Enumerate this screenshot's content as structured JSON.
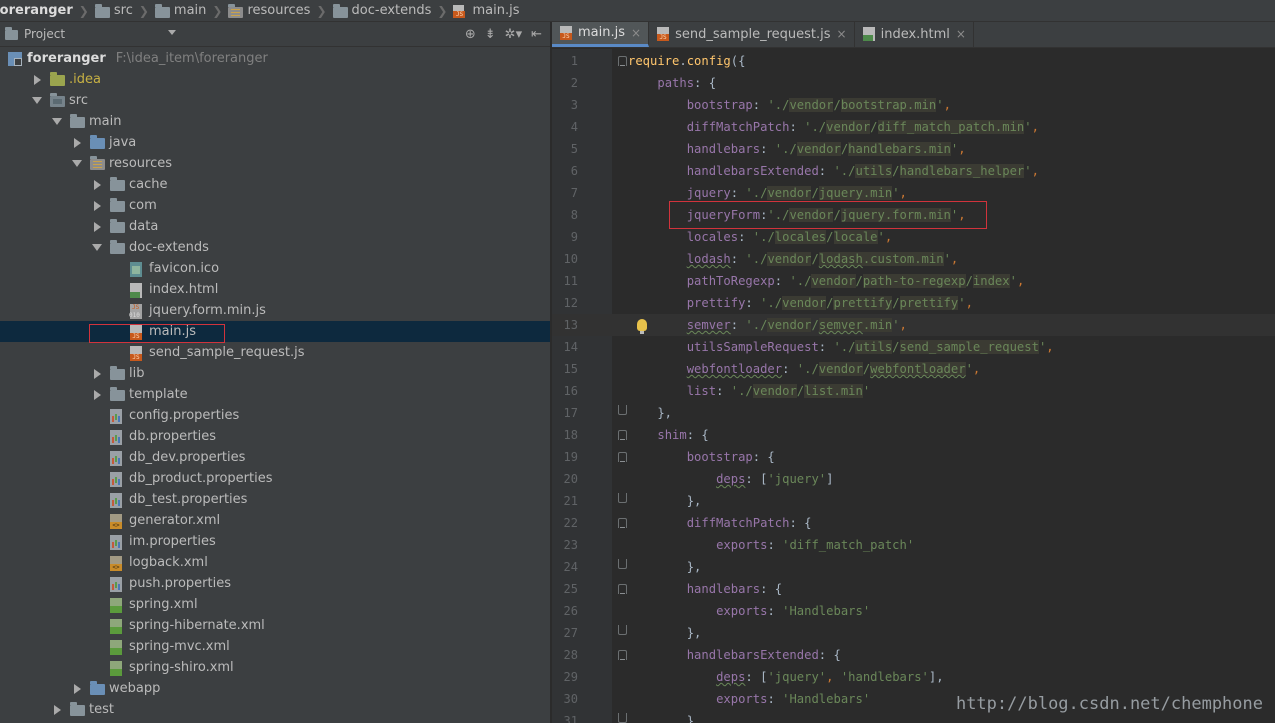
{
  "breadcrumb": [
    "foreranger",
    "src",
    "main",
    "resources",
    "doc-extends",
    "main.js"
  ],
  "project_panel": {
    "title": "Project",
    "root_name": "foreranger",
    "root_path": "F:\\idea_item\\foreranger",
    "tools": [
      "⊕",
      "⇟",
      "✲▾",
      "⇤"
    ]
  },
  "tree": [
    {
      "label": "foreranger",
      "depth": 0,
      "toggle": "none",
      "icon": "module",
      "root": true
    },
    {
      "label": ".idea",
      "depth": 1,
      "toggle": "closed",
      "icon": "folder-idea"
    },
    {
      "label": "src",
      "depth": 1,
      "toggle": "open",
      "icon": "folder-src"
    },
    {
      "label": "main",
      "depth": 2,
      "toggle": "open",
      "icon": "folder"
    },
    {
      "label": "java",
      "depth": 3,
      "toggle": "closed",
      "icon": "folder-blue"
    },
    {
      "label": "resources",
      "depth": 3,
      "toggle": "open",
      "icon": "folder-res"
    },
    {
      "label": "cache",
      "depth": 4,
      "toggle": "closed",
      "icon": "folder"
    },
    {
      "label": "com",
      "depth": 4,
      "toggle": "closed",
      "icon": "folder"
    },
    {
      "label": "data",
      "depth": 4,
      "toggle": "closed",
      "icon": "folder"
    },
    {
      "label": "doc-extends",
      "depth": 4,
      "toggle": "open",
      "icon": "folder"
    },
    {
      "label": "favicon.ico",
      "depth": 5,
      "toggle": "none",
      "icon": "ico"
    },
    {
      "label": "index.html",
      "depth": 5,
      "toggle": "none",
      "icon": "html"
    },
    {
      "label": "jquery.form.min.js",
      "depth": 5,
      "toggle": "none",
      "icon": "minjs"
    },
    {
      "label": "main.js",
      "depth": 5,
      "toggle": "none",
      "icon": "js",
      "selected": true
    },
    {
      "label": "send_sample_request.js",
      "depth": 5,
      "toggle": "none",
      "icon": "js"
    },
    {
      "label": "lib",
      "depth": 4,
      "toggle": "closed",
      "icon": "folder"
    },
    {
      "label": "template",
      "depth": 4,
      "toggle": "closed",
      "icon": "folder"
    },
    {
      "label": "config.properties",
      "depth": 4,
      "toggle": "none",
      "icon": "prop"
    },
    {
      "label": "db.properties",
      "depth": 4,
      "toggle": "none",
      "icon": "prop"
    },
    {
      "label": "db_dev.properties",
      "depth": 4,
      "toggle": "none",
      "icon": "prop"
    },
    {
      "label": "db_product.properties",
      "depth": 4,
      "toggle": "none",
      "icon": "prop"
    },
    {
      "label": "db_test.properties",
      "depth": 4,
      "toggle": "none",
      "icon": "prop"
    },
    {
      "label": "generator.xml",
      "depth": 4,
      "toggle": "none",
      "icon": "xml"
    },
    {
      "label": "im.properties",
      "depth": 4,
      "toggle": "none",
      "icon": "prop"
    },
    {
      "label": "logback.xml",
      "depth": 4,
      "toggle": "none",
      "icon": "xml"
    },
    {
      "label": "push.properties",
      "depth": 4,
      "toggle": "none",
      "icon": "prop"
    },
    {
      "label": "spring.xml",
      "depth": 4,
      "toggle": "none",
      "icon": "spring"
    },
    {
      "label": "spring-hibernate.xml",
      "depth": 4,
      "toggle": "none",
      "icon": "spring"
    },
    {
      "label": "spring-mvc.xml",
      "depth": 4,
      "toggle": "none",
      "icon": "spring"
    },
    {
      "label": "spring-shiro.xml",
      "depth": 4,
      "toggle": "none",
      "icon": "spring"
    },
    {
      "label": "webapp",
      "depth": 3,
      "toggle": "closed",
      "icon": "folder-blue"
    },
    {
      "label": "test",
      "depth": 2,
      "toggle": "closed",
      "icon": "folder"
    }
  ],
  "tabs": [
    {
      "label": "main.js",
      "icon": "js",
      "active": true
    },
    {
      "label": "send_sample_request.js",
      "icon": "js",
      "active": false
    },
    {
      "label": "index.html",
      "icon": "html",
      "active": false
    }
  ],
  "editor": {
    "current_line": 13,
    "bulb_line": 13,
    "lines": [
      {
        "n": 1,
        "fold": "open",
        "tokens": [
          [
            "fn",
            "require"
          ],
          [
            "plain",
            "."
          ],
          [
            "fn",
            "config"
          ],
          [
            "plain",
            "({"
          ]
        ]
      },
      {
        "n": 2,
        "fold": "",
        "tokens": [
          [
            "plain",
            "    "
          ],
          [
            "key",
            "paths"
          ],
          [
            "plain",
            ": {"
          ]
        ]
      },
      {
        "n": 3,
        "fold": "",
        "tokens": [
          [
            "plain",
            "        "
          ],
          [
            "key",
            "bootstrap"
          ],
          [
            "plain",
            ": "
          ],
          [
            "str",
            "'./"
          ],
          [
            "hl",
            "vendor"
          ],
          [
            "str",
            "/"
          ],
          [
            "hl",
            "bootstrap.min"
          ],
          [
            "str",
            "'"
          ],
          [
            "punc",
            ","
          ]
        ]
      },
      {
        "n": 4,
        "fold": "",
        "tokens": [
          [
            "plain",
            "        "
          ],
          [
            "key",
            "diffMatchPatch"
          ],
          [
            "plain",
            ": "
          ],
          [
            "str",
            "'./"
          ],
          [
            "hl",
            "vendor"
          ],
          [
            "str",
            "/"
          ],
          [
            "hl",
            "diff_match_patch.min"
          ],
          [
            "str",
            "'"
          ],
          [
            "punc",
            ","
          ]
        ]
      },
      {
        "n": 5,
        "fold": "",
        "tokens": [
          [
            "plain",
            "        "
          ],
          [
            "key",
            "handlebars"
          ],
          [
            "plain",
            ": "
          ],
          [
            "str",
            "'./"
          ],
          [
            "hl",
            "vendor"
          ],
          [
            "str",
            "/"
          ],
          [
            "hl",
            "handlebars.min"
          ],
          [
            "str",
            "'"
          ],
          [
            "punc",
            ","
          ]
        ]
      },
      {
        "n": 6,
        "fold": "",
        "tokens": [
          [
            "plain",
            "        "
          ],
          [
            "key",
            "handlebarsExtended"
          ],
          [
            "plain",
            ": "
          ],
          [
            "str",
            "'./"
          ],
          [
            "hl",
            "utils"
          ],
          [
            "str",
            "/"
          ],
          [
            "hl",
            "handlebars_helper"
          ],
          [
            "str",
            "'"
          ],
          [
            "punc",
            ","
          ]
        ]
      },
      {
        "n": 7,
        "fold": "",
        "tokens": [
          [
            "plain",
            "        "
          ],
          [
            "key",
            "jquery"
          ],
          [
            "plain",
            ": "
          ],
          [
            "str",
            "'./"
          ],
          [
            "hl",
            "vendor"
          ],
          [
            "str",
            "/"
          ],
          [
            "hl",
            "jquery.min"
          ],
          [
            "str",
            "'"
          ],
          [
            "punc",
            ","
          ]
        ]
      },
      {
        "n": 8,
        "fold": "",
        "tokens": [
          [
            "plain",
            "        "
          ],
          [
            "key",
            "jqueryForm"
          ],
          [
            "plain",
            ":"
          ],
          [
            "str",
            "'./"
          ],
          [
            "hl",
            "vendor"
          ],
          [
            "str",
            "/"
          ],
          [
            "hl",
            "jquery.form.min"
          ],
          [
            "str",
            "'"
          ],
          [
            "punc",
            ","
          ]
        ]
      },
      {
        "n": 9,
        "fold": "",
        "tokens": [
          [
            "plain",
            "        "
          ],
          [
            "key",
            "locales"
          ],
          [
            "plain",
            ": "
          ],
          [
            "str",
            "'./"
          ],
          [
            "hl",
            "locales"
          ],
          [
            "str",
            "/"
          ],
          [
            "hl",
            "locale"
          ],
          [
            "str",
            "'"
          ],
          [
            "punc",
            ","
          ]
        ]
      },
      {
        "n": 10,
        "fold": "",
        "tokens": [
          [
            "plain",
            "        "
          ],
          [
            "keysq",
            "lodash"
          ],
          [
            "plain",
            ": "
          ],
          [
            "str",
            "'./"
          ],
          [
            "hl",
            "vendor"
          ],
          [
            "str",
            "/"
          ],
          [
            "hlsq",
            "lodash"
          ],
          [
            "hl",
            ".custom.min"
          ],
          [
            "str",
            "'"
          ],
          [
            "punc",
            ","
          ]
        ]
      },
      {
        "n": 11,
        "fold": "",
        "tokens": [
          [
            "plain",
            "        "
          ],
          [
            "key",
            "pathToRegexp"
          ],
          [
            "plain",
            ": "
          ],
          [
            "str",
            "'./"
          ],
          [
            "hl",
            "vendor"
          ],
          [
            "str",
            "/"
          ],
          [
            "hl",
            "path-to-regexp"
          ],
          [
            "str",
            "/"
          ],
          [
            "hl",
            "index"
          ],
          [
            "str",
            "'"
          ],
          [
            "punc",
            ","
          ]
        ]
      },
      {
        "n": 12,
        "fold": "",
        "tokens": [
          [
            "plain",
            "        "
          ],
          [
            "key",
            "prettify"
          ],
          [
            "plain",
            ": "
          ],
          [
            "str",
            "'./"
          ],
          [
            "hl",
            "vendor"
          ],
          [
            "str",
            "/"
          ],
          [
            "hl",
            "prettify"
          ],
          [
            "str",
            "/"
          ],
          [
            "hl",
            "prettify"
          ],
          [
            "str",
            "'"
          ],
          [
            "punc",
            ","
          ]
        ]
      },
      {
        "n": 13,
        "fold": "",
        "tokens": [
          [
            "plain",
            "        "
          ],
          [
            "keysq",
            "semver"
          ],
          [
            "plain",
            ": "
          ],
          [
            "str",
            "'./"
          ],
          [
            "hl",
            "vendor"
          ],
          [
            "str",
            "/"
          ],
          [
            "hlsq",
            "semver"
          ],
          [
            "hl",
            ".min"
          ],
          [
            "str",
            "'"
          ],
          [
            "punc",
            ","
          ]
        ]
      },
      {
        "n": 14,
        "fold": "",
        "tokens": [
          [
            "plain",
            "        "
          ],
          [
            "key",
            "utilsSampleRequest"
          ],
          [
            "plain",
            ": "
          ],
          [
            "str",
            "'./"
          ],
          [
            "hl",
            "utils"
          ],
          [
            "str",
            "/"
          ],
          [
            "hl",
            "send_sample_request"
          ],
          [
            "str",
            "'"
          ],
          [
            "punc",
            ","
          ]
        ]
      },
      {
        "n": 15,
        "fold": "",
        "tokens": [
          [
            "plain",
            "        "
          ],
          [
            "keysq",
            "webfontloader"
          ],
          [
            "plain",
            ": "
          ],
          [
            "str",
            "'./"
          ],
          [
            "hl",
            "vendor"
          ],
          [
            "str",
            "/"
          ],
          [
            "hlsq",
            "webfontloader"
          ],
          [
            "str",
            "'"
          ],
          [
            "punc",
            ","
          ]
        ]
      },
      {
        "n": 16,
        "fold": "",
        "tokens": [
          [
            "plain",
            "        "
          ],
          [
            "key",
            "list"
          ],
          [
            "plain",
            ": "
          ],
          [
            "str",
            "'./"
          ],
          [
            "hl",
            "vendor"
          ],
          [
            "str",
            "/"
          ],
          [
            "hl",
            "list.min"
          ],
          [
            "str",
            "'"
          ]
        ]
      },
      {
        "n": 17,
        "fold": "end",
        "tokens": [
          [
            "plain",
            "    },"
          ]
        ]
      },
      {
        "n": 18,
        "fold": "open",
        "tokens": [
          [
            "plain",
            "    "
          ],
          [
            "key",
            "shim"
          ],
          [
            "plain",
            ": {"
          ]
        ]
      },
      {
        "n": 19,
        "fold": "open",
        "tokens": [
          [
            "plain",
            "        "
          ],
          [
            "key",
            "bootstrap"
          ],
          [
            "plain",
            ": {"
          ]
        ]
      },
      {
        "n": 20,
        "fold": "",
        "tokens": [
          [
            "plain",
            "            "
          ],
          [
            "keysq",
            "deps"
          ],
          [
            "plain",
            ": ["
          ],
          [
            "str",
            "'jquery'"
          ],
          [
            "plain",
            "]"
          ]
        ]
      },
      {
        "n": 21,
        "fold": "end",
        "tokens": [
          [
            "plain",
            "        },"
          ]
        ]
      },
      {
        "n": 22,
        "fold": "open",
        "tokens": [
          [
            "plain",
            "        "
          ],
          [
            "key",
            "diffMatchPatch"
          ],
          [
            "plain",
            ": {"
          ]
        ]
      },
      {
        "n": 23,
        "fold": "",
        "tokens": [
          [
            "plain",
            "            "
          ],
          [
            "key",
            "exports"
          ],
          [
            "plain",
            ": "
          ],
          [
            "str",
            "'diff_match_patch'"
          ]
        ]
      },
      {
        "n": 24,
        "fold": "end",
        "tokens": [
          [
            "plain",
            "        },"
          ]
        ]
      },
      {
        "n": 25,
        "fold": "open",
        "tokens": [
          [
            "plain",
            "        "
          ],
          [
            "key",
            "handlebars"
          ],
          [
            "plain",
            ": {"
          ]
        ]
      },
      {
        "n": 26,
        "fold": "",
        "tokens": [
          [
            "plain",
            "            "
          ],
          [
            "key",
            "exports"
          ],
          [
            "plain",
            ": "
          ],
          [
            "str",
            "'Handlebars'"
          ]
        ]
      },
      {
        "n": 27,
        "fold": "end",
        "tokens": [
          [
            "plain",
            "        },"
          ]
        ]
      },
      {
        "n": 28,
        "fold": "open",
        "tokens": [
          [
            "plain",
            "        "
          ],
          [
            "key",
            "handlebarsExtended"
          ],
          [
            "plain",
            ": {"
          ]
        ]
      },
      {
        "n": 29,
        "fold": "",
        "tokens": [
          [
            "plain",
            "            "
          ],
          [
            "keysq",
            "deps"
          ],
          [
            "plain",
            ": ["
          ],
          [
            "str",
            "'jquery'"
          ],
          [
            "punc",
            ", "
          ],
          [
            "str",
            "'handlebars'"
          ],
          [
            "plain",
            "],"
          ]
        ]
      },
      {
        "n": 30,
        "fold": "",
        "tokens": [
          [
            "plain",
            "            "
          ],
          [
            "key",
            "exports"
          ],
          [
            "plain",
            ": "
          ],
          [
            "str",
            "'Handlebars'"
          ]
        ]
      },
      {
        "n": 31,
        "fold": "end",
        "tokens": [
          [
            "plain",
            "        }"
          ]
        ]
      }
    ]
  },
  "watermark": "http://blog.csdn.net/chemphone",
  "colors": {
    "highlight_box": "#d1333c",
    "selection": "#0d293e",
    "accent": "#5a8ac6"
  }
}
